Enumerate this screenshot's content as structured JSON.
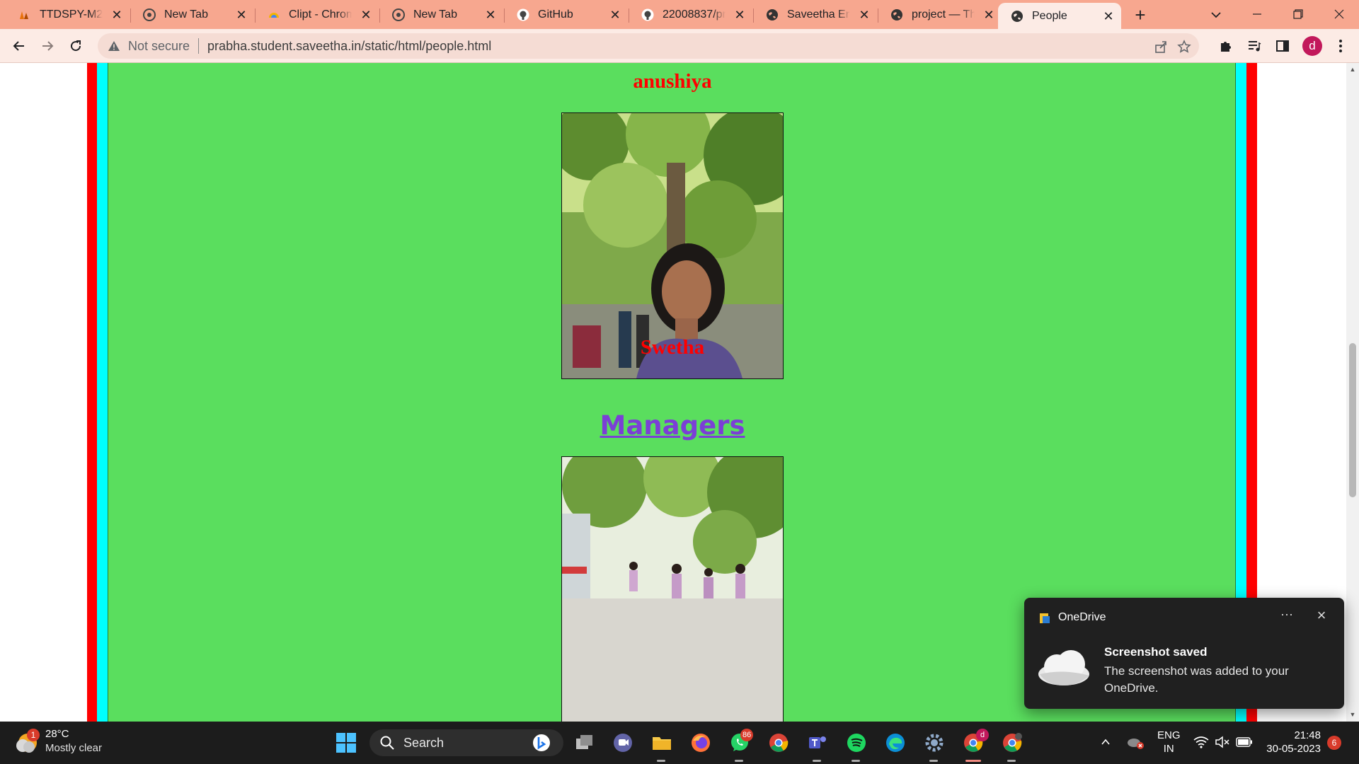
{
  "browser": {
    "tabs": [
      {
        "title": "TTDSPY-M2: M",
        "icon": "mooc-icon"
      },
      {
        "title": "New Tab",
        "icon": "chrome-icon"
      },
      {
        "title": "Clipt - Chrome",
        "icon": "clipt-icon"
      },
      {
        "title": "New Tab",
        "icon": "chrome-icon"
      },
      {
        "title": "GitHub",
        "icon": "github-icon"
      },
      {
        "title": "22008837/pro",
        "icon": "github-icon"
      },
      {
        "title": "Saveetha Engi",
        "icon": "globe-icon"
      },
      {
        "title": "project — The",
        "icon": "globe-icon"
      },
      {
        "title": "People",
        "icon": "globe-icon",
        "active": true
      }
    ],
    "new_tab_label": "+",
    "security_label": "Not secure",
    "url": "prabha.student.saveetha.in/static/html/people.html",
    "profile_initial": "d"
  },
  "page": {
    "background": "#5ade5e",
    "names": [
      "anushiya",
      "Swetha"
    ],
    "section_heading": "Managers"
  },
  "toast": {
    "app_name": "OneDrive",
    "title": "Screenshot saved",
    "body": "The screenshot was added to your OneDrive."
  },
  "taskbar": {
    "weather_badge": "1",
    "temperature": "28°C",
    "weather_desc": "Mostly clear",
    "search_label": "Search",
    "whatsapp_badge": "86",
    "chrome_profile_badge": "d",
    "language_line1": "ENG",
    "language_line2": "IN",
    "time": "21:48",
    "date": "30-05-2023",
    "notification_count": "6"
  }
}
